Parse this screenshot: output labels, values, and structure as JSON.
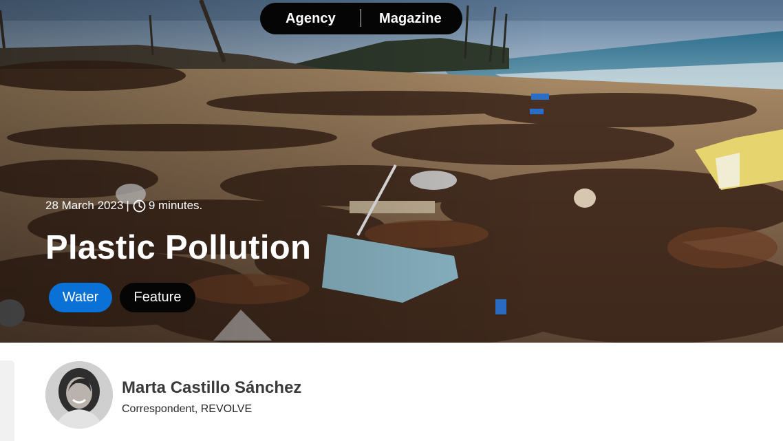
{
  "nav": {
    "agency_label": "Agency",
    "magazine_label": "Magazine"
  },
  "article": {
    "date": "28 March 2023",
    "separator": "|",
    "read_time": "9 minutes.",
    "title": "Plastic Pollution",
    "tags": [
      {
        "label": "Water",
        "color": "#0a72d6"
      },
      {
        "label": "Feature",
        "color": "#050505"
      }
    ],
    "hero_image": "beach covered with seaweed and plastic waste"
  },
  "author": {
    "name": "Marta Castillo Sánchez",
    "role": "Correspondent, REVOLVE"
  },
  "icons": {
    "clock": "clock-icon"
  }
}
